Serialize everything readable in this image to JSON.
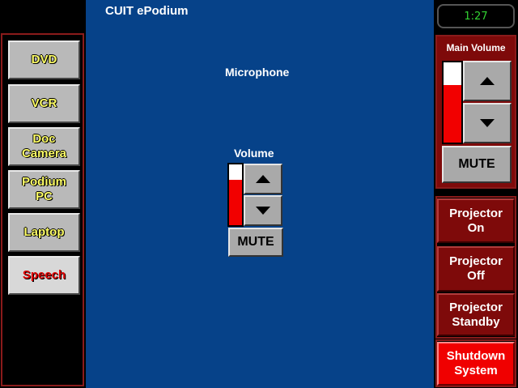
{
  "app": {
    "title": "CUIT ePodium"
  },
  "clock": "1:27",
  "sources": [
    {
      "label": "DVD",
      "active": false
    },
    {
      "label": "VCR",
      "active": false
    },
    {
      "label": "Doc\nCamera",
      "active": false
    },
    {
      "label": "Podium\nPC",
      "active": false
    },
    {
      "label": "Laptop",
      "active": false
    },
    {
      "label": "Speech",
      "active": true
    }
  ],
  "microphone": {
    "title": "Microphone",
    "volume_label": "Volume",
    "level_pct": 75,
    "up_icon": "up-arrow-icon",
    "down_icon": "down-arrow-icon",
    "mute_label": "MUTE"
  },
  "main_volume": {
    "title": "Main Volume",
    "level_pct": 72,
    "up_icon": "up-arrow-icon",
    "down_icon": "down-arrow-icon",
    "mute_label": "MUTE"
  },
  "projector": {
    "on_label": "Projector\nOn",
    "off_label": "Projector\nOff",
    "standby_label": "Projector\nStandby"
  },
  "shutdown_label": "Shutdown\nSystem",
  "colors": {
    "main_bg": "#064289",
    "panel_red": "#7e0a0a",
    "level_red": "#f20000",
    "source_text": "#ffff66",
    "active_source_text": "#e00000",
    "clock_text": "#32d232",
    "shutdown_red": "#f00000"
  }
}
